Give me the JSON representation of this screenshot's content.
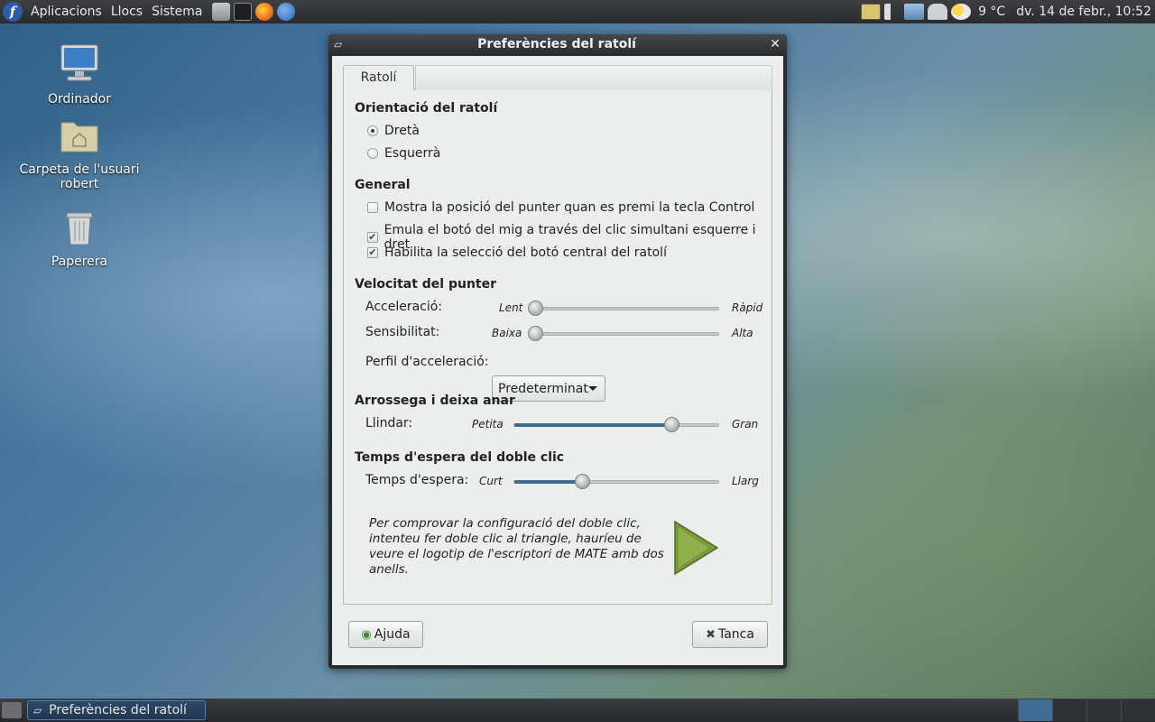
{
  "top_panel": {
    "menus": [
      "Aplicacions",
      "Llocs",
      "Sistema"
    ],
    "launchers": [
      "files-icon",
      "terminal-icon",
      "firefox-icon",
      "thunderbird-icon"
    ],
    "weather": "9 °C",
    "clock": "dv. 14 de febr., 10:52"
  },
  "desktop": {
    "icons": [
      {
        "label": "Ordinador"
      },
      {
        "label": "Carpeta de l'usuari robert"
      },
      {
        "label": "Paperera"
      }
    ]
  },
  "window": {
    "title": "Preferències del ratolí",
    "tab": "Ratolí",
    "orientation": {
      "title": "Orientació del ratolí",
      "right": "Dretà",
      "left": "Esquerrà",
      "selected": "right"
    },
    "general": {
      "title": "General",
      "show_pointer": "Mostra la posició del punter quan es premi la tecla Control",
      "show_pointer_checked": false,
      "emulate_middle": "Emula el botó del mig a través del clic simultani esquerre i dret",
      "emulate_middle_checked": true,
      "middle_paste": "Habilita la selecció del botó central del ratolí",
      "middle_paste_checked": true
    },
    "speed": {
      "title": "Velocitat del punter",
      "acceleration_label": "Acceleració:",
      "acceleration_low": "Lent",
      "acceleration_high": "Ràpid",
      "acceleration_value": 0.0,
      "sensitivity_label": "Sensibilitat:",
      "sensitivity_low": "Baixa",
      "sensitivity_high": "Alta",
      "sensitivity_value": 0.0,
      "profile_label": "Perfil d'acceleració:",
      "profile_value": "Predeterminat"
    },
    "drag": {
      "title": "Arrossega i deixa anar",
      "threshold_label": "Llindar:",
      "threshold_low": "Petita",
      "threshold_high": "Gran",
      "threshold_value": 0.77
    },
    "double_click": {
      "title": "Temps d'espera del doble clic",
      "timeout_label": "Temps d'espera:",
      "timeout_low": "Curt",
      "timeout_high": "Llarg",
      "timeout_value": 0.33,
      "info": "Per comprovar la configuració del doble clic, intenteu fer doble clic al triangle, hauríeu de veure el logotip de l'escriptori de MATE amb dos anells."
    },
    "help_button": "Ajuda",
    "close_button": "Tanca"
  },
  "bottom_panel": {
    "task": "Preferències del ratolí"
  },
  "colors": {
    "accent": "#3f6a90",
    "triangle": "#7a9a3a"
  }
}
